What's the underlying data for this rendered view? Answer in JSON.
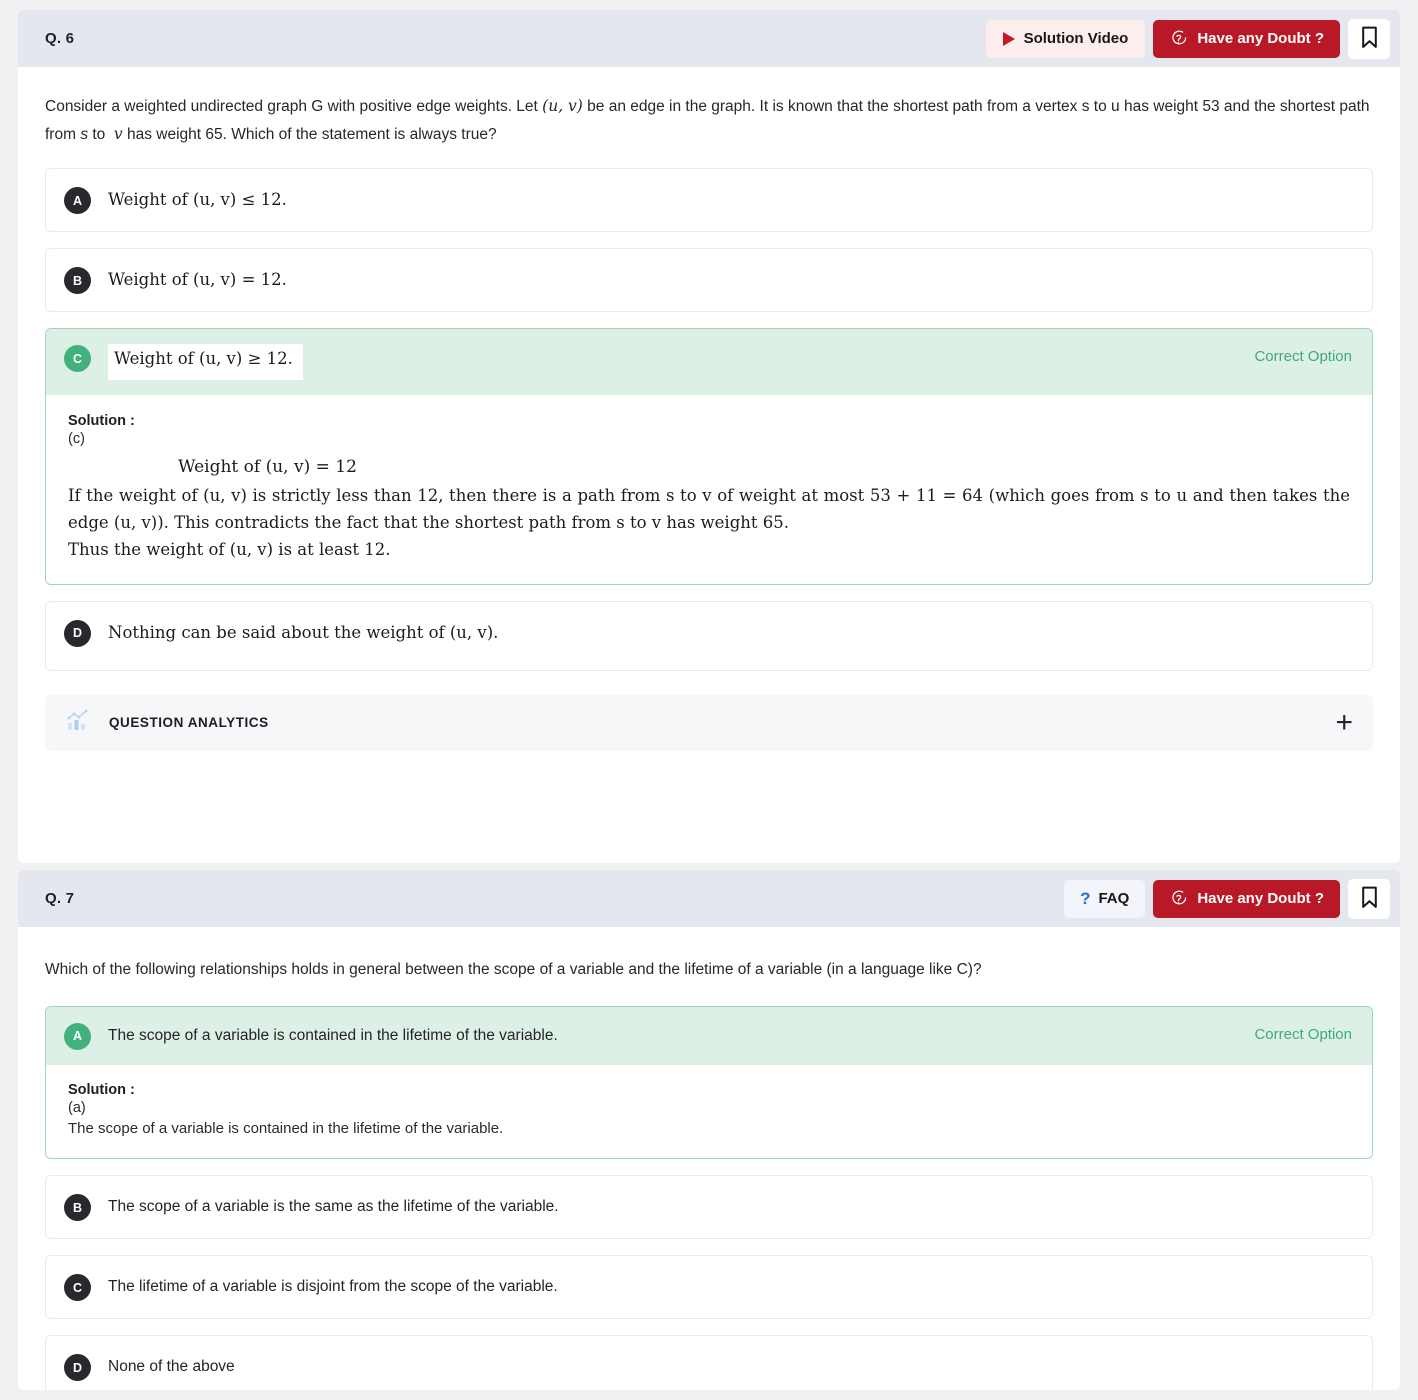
{
  "questions": [
    {
      "label": "Q. 6",
      "actions": {
        "solution_video": "Solution Video",
        "doubt": "Have any Doubt ?",
        "bookmark_icon": "bookmark-icon",
        "play_icon": "play-icon",
        "doubt_icon": "chat-question-icon"
      },
      "prompt": {
        "part1": "Consider a weighted undirected graph G with positive edge weights. Let ",
        "math1": "(u, v)",
        "part2": " be an edge in the graph. It is known that the shortest path from a vertex s to u has weight 53 and the shortest path from ",
        "math2": "s",
        "part3": " to ",
        "math3": "v",
        "part4": " has weight 65. Which of the statement is always true?"
      },
      "options": [
        {
          "badge": "A",
          "text": "Weight of (u, v) ≤ 12.",
          "correct": false
        },
        {
          "badge": "B",
          "text": "Weight of (u, v) = 12.",
          "correct": false
        },
        {
          "badge": "C",
          "text": "Weight of (u, v) ≥ 12.",
          "correct": true,
          "correct_tag": "Correct Option"
        },
        {
          "badge": "D",
          "text": "Nothing can be said about the weight of (u, v).",
          "correct": false
        }
      ],
      "solution": {
        "title": "Solution :",
        "sub": "(c)",
        "formula": "Weight of (u, v)  =  12",
        "body": "If the weight of (u, v) is strictly less than 12, then there is a path from s to v of weight at most 53 + 11 = 64 (which goes from s to u and then takes the edge (u, v)). This contradicts the fact that the shortest path from s to v has weight 65.",
        "body2": "Thus the weight of (u, v) is at least 12."
      },
      "analytics": {
        "label": "QUESTION ANALYTICS",
        "icon": "bar-chart-icon",
        "expand": "+"
      }
    },
    {
      "label": "Q. 7",
      "actions": {
        "faq": "FAQ",
        "faq_icon": "question-mark-icon",
        "doubt": "Have any Doubt ?",
        "bookmark_icon": "bookmark-icon",
        "doubt_icon": "chat-question-icon"
      },
      "prompt": {
        "full": "Which of the following relationships holds in general between the scope of a variable and the lifetime of a variable (in a language like C)?"
      },
      "options": [
        {
          "badge": "A",
          "text": "The scope of a variable is contained in the lifetime of the variable.",
          "correct": true,
          "correct_tag": "Correct Option"
        },
        {
          "badge": "B",
          "text": "The scope of a variable is the same as the lifetime of the variable.",
          "correct": false
        },
        {
          "badge": "C",
          "text": "The lifetime of a variable is disjoint from the scope of the variable.",
          "correct": false
        },
        {
          "badge": "D",
          "text": "None of the above",
          "correct": false
        }
      ],
      "solution": {
        "title": "Solution :",
        "sub": "(a)",
        "body": "The scope of a variable is contained in the lifetime of the variable."
      }
    }
  ],
  "colors": {
    "brand_red": "#b91826",
    "soft_red_bg": "#fdeeee",
    "correct_green": "#43b17e",
    "correct_green_bg": "#ddf0e6",
    "header_band": "#e5e7ef",
    "faq_blue": "#1e6fe0",
    "page_bg": "#f1f1f3"
  }
}
